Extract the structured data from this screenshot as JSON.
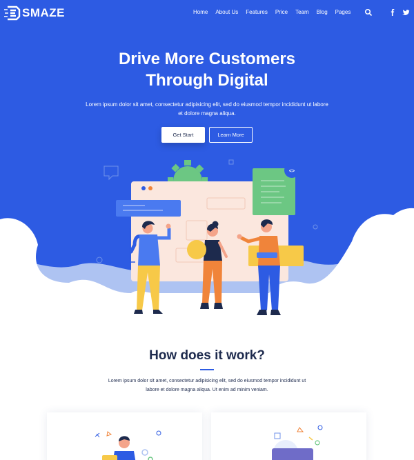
{
  "brand": {
    "name": "SMAZE"
  },
  "nav": {
    "items": [
      "Home",
      "About Us",
      "Features",
      "Price",
      "Team",
      "Blog",
      "Pages"
    ],
    "icons": [
      "search-icon",
      "facebook-icon",
      "twitter-icon",
      "dribbble-icon"
    ]
  },
  "hero": {
    "title_line1": "Drive More Customers",
    "title_line2": "Through Digital",
    "text": "Lorem ipsum dolor sit amet, consectetur adipisicing elit, sed do eiusmod tempor incididunt ut labore et dolore magna aliqua.",
    "primary_button": "Get Start",
    "secondary_button": "Learn More",
    "code_badge": "<>"
  },
  "how": {
    "title": "How does it work?",
    "text": "Lorem ipsum dolor sit amet, consectetur adipisicing elit, sed do eiusmod tempor incididunt ut labore et dolore magna aliqua. Ut enim ad minim veniam."
  },
  "colors": {
    "primary": "#2d5be3",
    "heading": "#1d2a4d",
    "accent_green": "#6cc783",
    "accent_yellow": "#f7c948",
    "accent_orange": "#f0843a"
  }
}
